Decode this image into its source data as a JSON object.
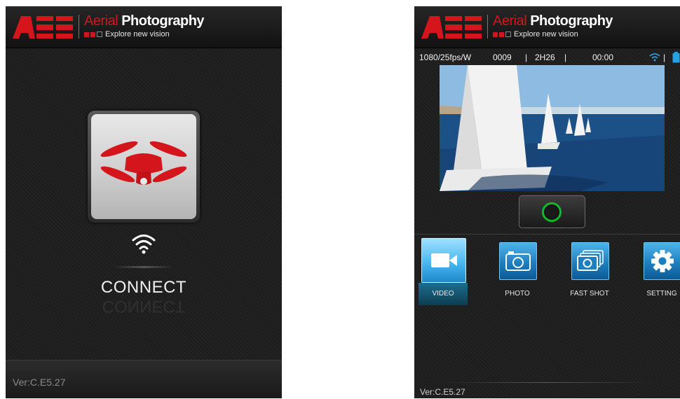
{
  "connect_screen": {
    "logo": {
      "brand": "AEE",
      "title_part1": "Aerial",
      "title_part2": "Photography",
      "subtitle": "Explore new vision"
    },
    "connect_label": "CONNECT",
    "version": "Ver:C.E5.27",
    "icons": {
      "drone": "drone-icon",
      "wifi": "wifi-icon"
    }
  },
  "main_screen": {
    "logo": {
      "brand": "AEE",
      "title_part1": "Aerial",
      "title_part2": "Photography",
      "subtitle": "Explore new vision"
    },
    "status": {
      "resolution": "1080/25fps/W",
      "count": "0009",
      "sep1": "|",
      "remaining": "2H26",
      "sep2": "|",
      "timer": "00:00",
      "sep3": "|"
    },
    "modes": [
      {
        "label": "VIDEO",
        "icon": "video-camera-icon",
        "active": true
      },
      {
        "label": "PHOTO",
        "icon": "camera-icon",
        "active": false
      },
      {
        "label": "FAST SHOT",
        "icon": "burst-camera-icon",
        "active": false
      },
      {
        "label": "SETTING",
        "icon": "gear-icon",
        "active": false
      }
    ],
    "version": "Ver:C.E5.27"
  },
  "colors": {
    "brand_red": "#d4161c",
    "accent_blue": "#2aa0e0",
    "record_green": "#12b82a"
  }
}
